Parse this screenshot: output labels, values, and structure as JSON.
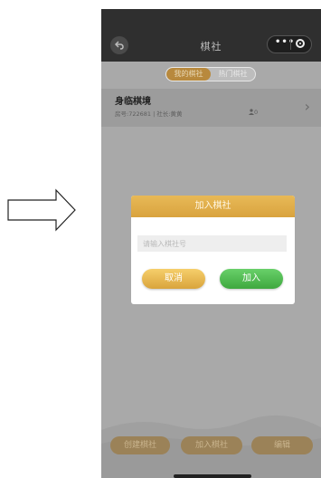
{
  "navbar": {
    "title": "棋社",
    "back_icon": "back-icon",
    "more_icon": "more-dots-icon",
    "close_icon": "target-icon",
    "more_label": "•••"
  },
  "tabs": [
    {
      "label": "我的棋社",
      "active": true
    },
    {
      "label": "热门棋社",
      "active": false
    }
  ],
  "club": {
    "name": "身临棋境",
    "meta": "房号:722681 | 社长:黄黄",
    "count": "0"
  },
  "dialog": {
    "title": "加入棋社",
    "input_placeholder": "请输入棋社号",
    "cancel_label": "取消",
    "join_label": "加入"
  },
  "bottom_buttons": [
    {
      "label": "创建棋社"
    },
    {
      "label": "加入棋社"
    },
    {
      "label": "编辑"
    }
  ],
  "colors": {
    "gold": "#d9a43c",
    "green": "#3ea83e",
    "navbar": "#2f2f2f",
    "overlay": "#a9a9a9"
  }
}
